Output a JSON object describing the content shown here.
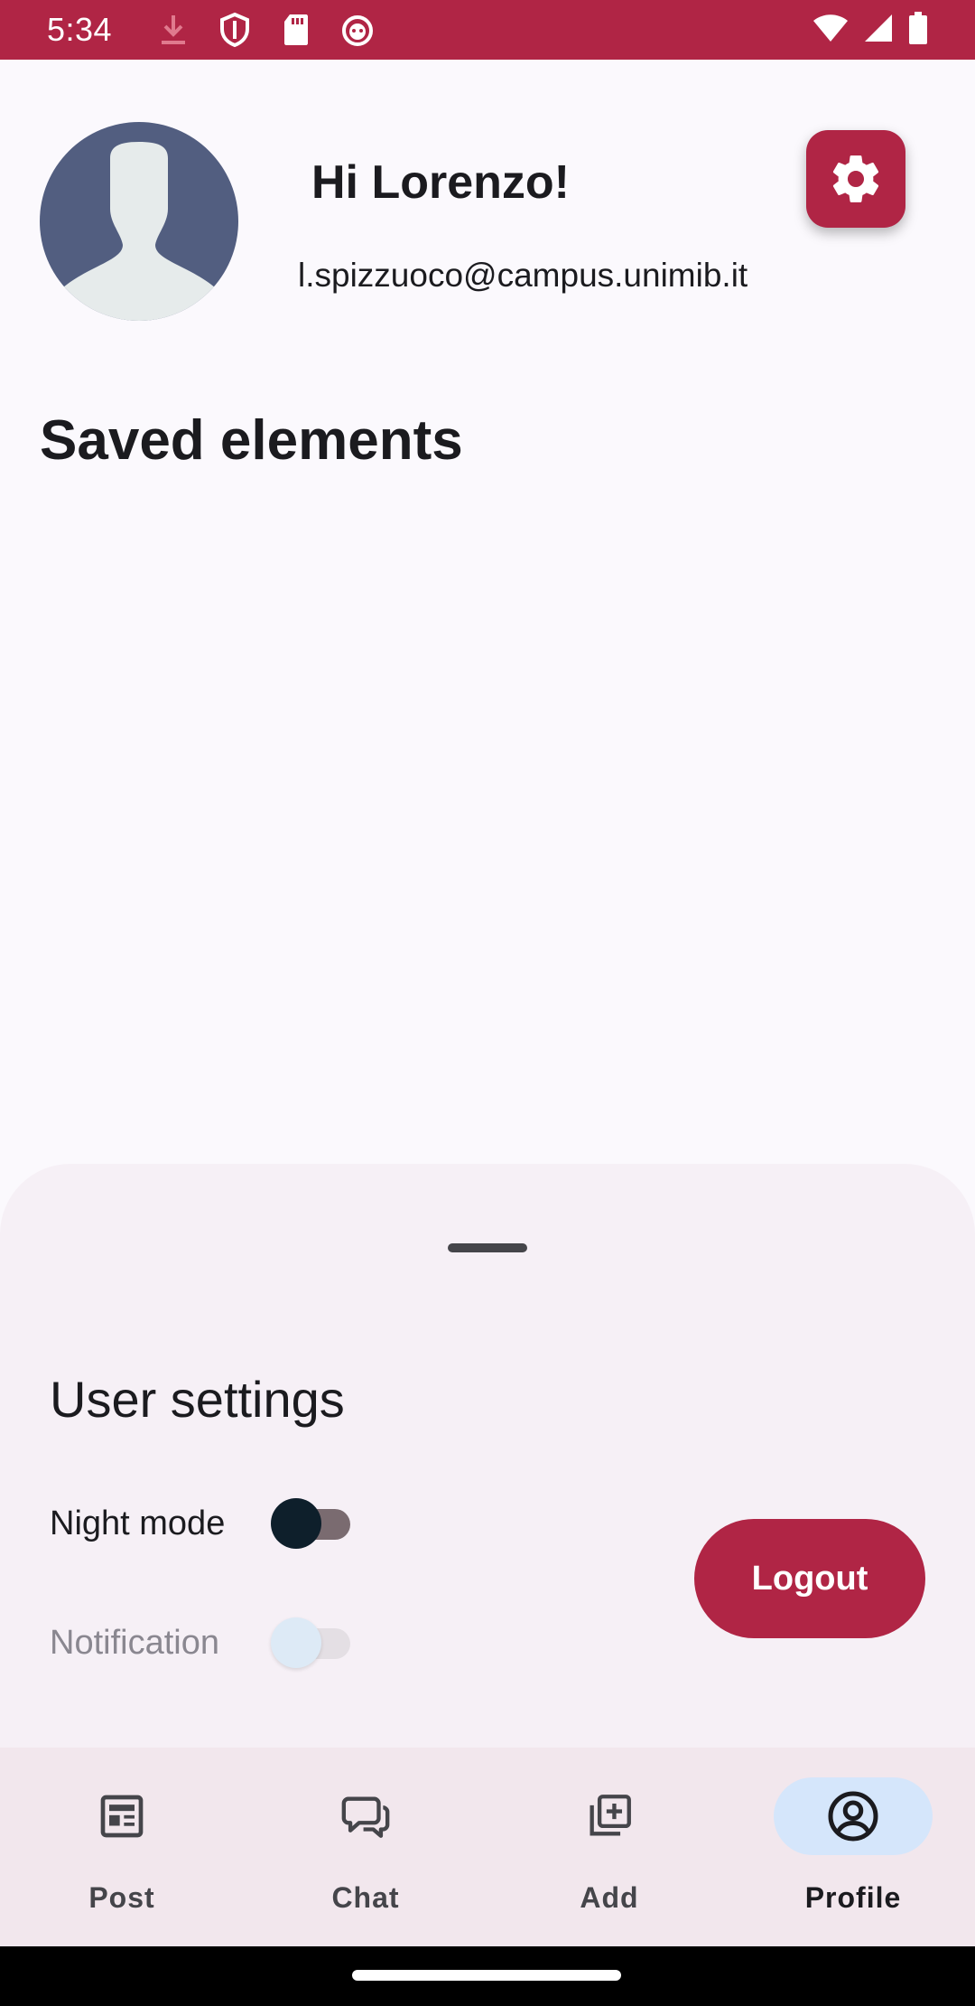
{
  "status_bar": {
    "time": "5:34",
    "left_icons": [
      "download-icon",
      "shield-icon",
      "sd-card-icon",
      "cat-icon"
    ],
    "right_icons": [
      "wifi-icon",
      "signal-icon",
      "battery-icon"
    ]
  },
  "profile": {
    "greeting": "Hi Lorenzo!",
    "email": "l.spizzuoco@campus.unimib.it"
  },
  "saved": {
    "title": "Saved elements"
  },
  "settings_sheet": {
    "title": "User settings",
    "night_mode": {
      "label": "Night mode",
      "enabled": true
    },
    "notification": {
      "label": "Notification",
      "enabled": false
    },
    "logout_label": "Logout"
  },
  "bottom_nav": {
    "items": [
      {
        "label": "Post",
        "icon": "newspaper-icon",
        "active": false
      },
      {
        "label": "Chat",
        "icon": "chat-icon",
        "active": false
      },
      {
        "label": "Add",
        "icon": "add-library-icon",
        "active": false
      },
      {
        "label": "Profile",
        "icon": "account-circle-icon",
        "active": true
      }
    ]
  },
  "colors": {
    "primary": "#b02545",
    "background": "#fbf9fd",
    "sheet": "#f6f0f6",
    "nav_bar": "#f2e7ed",
    "active_pill": "#d5e6fb",
    "avatar": "#525e80"
  }
}
